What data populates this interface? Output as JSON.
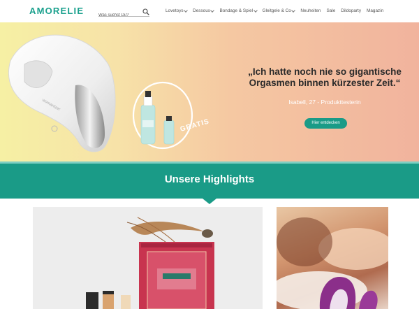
{
  "header": {
    "logo": "AMORELIE",
    "search_placeholder": "Was suchst Du?",
    "nav": [
      {
        "label": "Lovetoys",
        "dropdown": true
      },
      {
        "label": "Dessous",
        "dropdown": true
      },
      {
        "label": "Bondage & Spiel",
        "dropdown": true
      },
      {
        "label": "Gleitgele & Co",
        "dropdown": true
      },
      {
        "label": "Neuheiten",
        "dropdown": false
      },
      {
        "label": "Sale",
        "dropdown": false
      },
      {
        "label": "Dildoparty",
        "dropdown": false
      },
      {
        "label": "Magazin",
        "dropdown": false
      }
    ]
  },
  "hero": {
    "quote_line1": "„Ich hatte noch nie so gigantische",
    "quote_line2": "Orgasmen binnen kürzester Zeit.“",
    "author": "Isabell, 27 - Produkttesterin",
    "cta": "Hier entdecken",
    "badge": "GRATIS",
    "product_label": "AMORELIE"
  },
  "highlights": {
    "title": "Unsere Highlights"
  },
  "colors": {
    "brand": "#1aa08d",
    "accent": "#1a9b87"
  }
}
